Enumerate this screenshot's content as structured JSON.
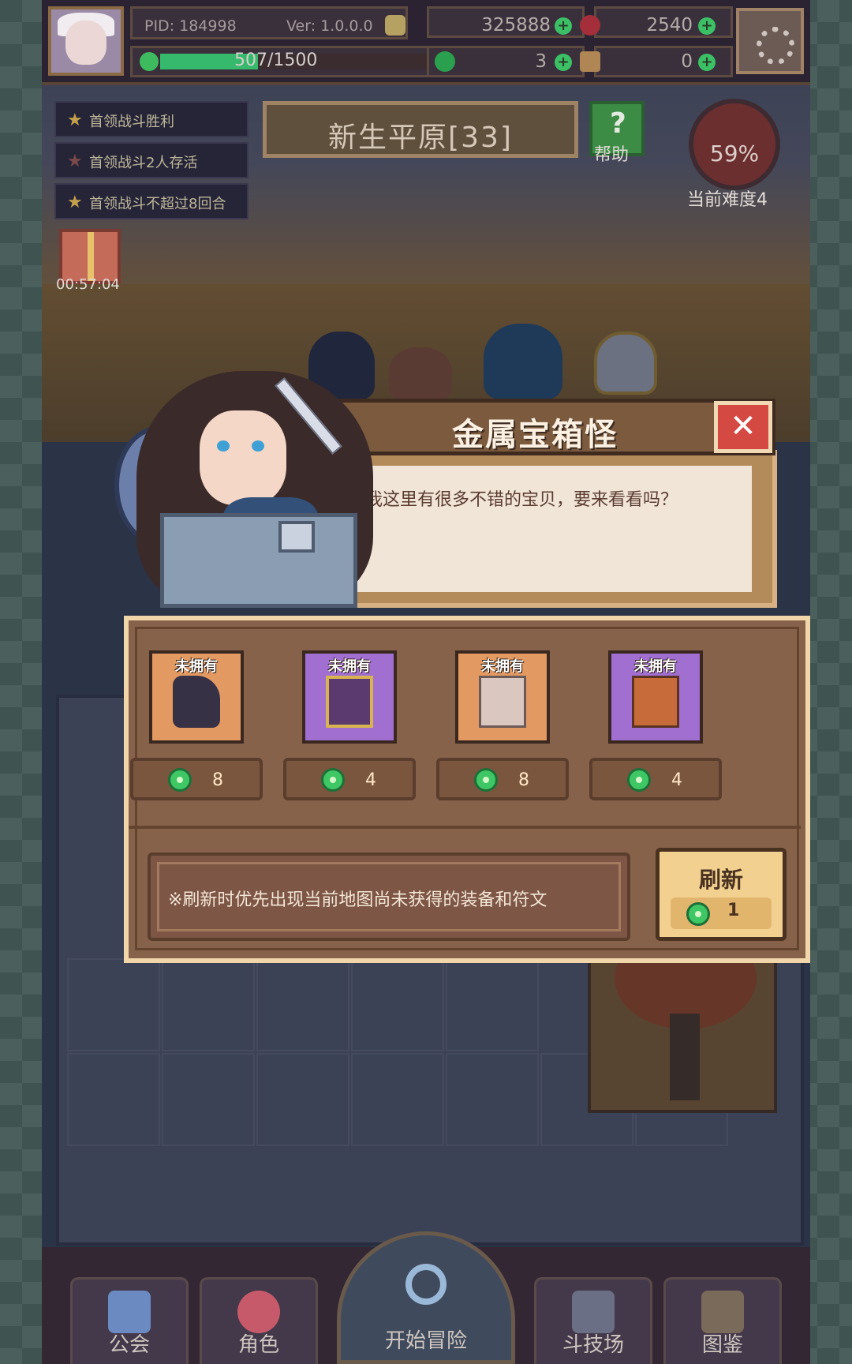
{
  "topbar": {
    "pid": "PID: 184998",
    "version": "Ver: 1.0.0.0",
    "gold": "325888",
    "gems": "2540",
    "exp": "507/1500",
    "exp_fraction": 0.338,
    "clovers": "3",
    "tickets": "0"
  },
  "objectives": [
    {
      "label": "首领战斗胜利"
    },
    {
      "label": "首领战斗2人存活"
    },
    {
      "label": "首领战斗不超过8回合"
    }
  ],
  "map": {
    "title": "新生平原[33]",
    "help_label": "帮助",
    "difficulty_percent": "59%",
    "difficulty_label": "当前难度4"
  },
  "gift": {
    "timer": "00:57:04"
  },
  "dialog": {
    "title": "金属宝箱怪",
    "close_symbol": "✕",
    "message": "我这里有很多不错的宝贝，要来看看吗？"
  },
  "shop": {
    "items": [
      {
        "tag": "未拥有",
        "price": "8",
        "rarity": "orange"
      },
      {
        "tag": "未拥有",
        "price": "4",
        "rarity": "purple"
      },
      {
        "tag": "未拥有",
        "price": "8",
        "rarity": "orange"
      },
      {
        "tag": "未拥有",
        "price": "4",
        "rarity": "purple"
      }
    ],
    "note": "※刷新时优先出现当前地图尚未获得的装备和符文",
    "refresh_label": "刷新",
    "refresh_cost": "1"
  },
  "nav": {
    "guild": "公会",
    "character": "角色",
    "adventure": "开始冒险",
    "arena": "斗技场",
    "codex": "图鉴"
  },
  "colors": {
    "clover": "#3ec764",
    "close_button": "#d44a42",
    "refresh_button": "#f2d190",
    "slot_orange": "#e29a62",
    "slot_purple": "#a06fd0"
  }
}
